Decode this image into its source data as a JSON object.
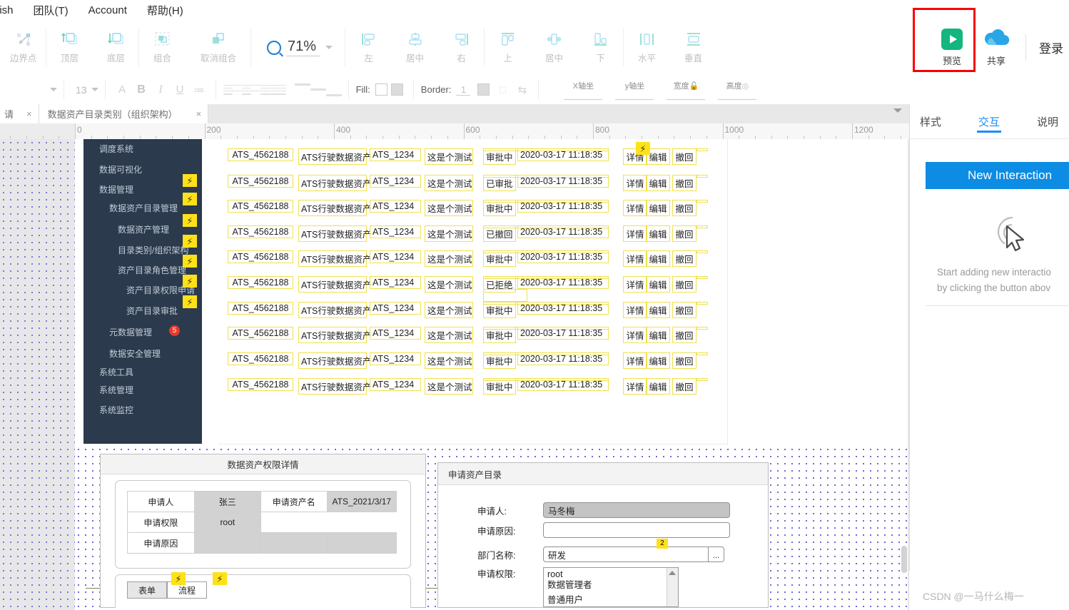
{
  "menubar": {
    "items": [
      {
        "label": "lish",
        "name": "menu-english"
      },
      {
        "label": "团队(T)",
        "name": "menu-team"
      },
      {
        "label": "Account",
        "name": "menu-account"
      },
      {
        "label": "帮助(H)",
        "name": "menu-help"
      }
    ]
  },
  "toolbar": {
    "groups": [
      {
        "name": "points",
        "buttons": [
          {
            "label": "边界点",
            "icon": "boundary-point-icon"
          }
        ]
      },
      {
        "name": "layer",
        "buttons": [
          {
            "label": "顶层",
            "icon": "bring-to-front-icon"
          },
          {
            "label": "底层",
            "icon": "send-to-back-icon"
          }
        ]
      },
      {
        "name": "group",
        "buttons": [
          {
            "label": "组合",
            "icon": "group-icon"
          },
          {
            "label": "取消组合",
            "icon": "ungroup-icon"
          }
        ]
      },
      {
        "name": "align-h",
        "buttons": [
          {
            "label": "左",
            "icon": "align-left-icon"
          },
          {
            "label": "居中",
            "icon": "align-center-icon"
          },
          {
            "label": "右",
            "icon": "align-right-icon"
          }
        ]
      },
      {
        "name": "align-v",
        "buttons": [
          {
            "label": "上",
            "icon": "align-top-icon"
          },
          {
            "label": "居中",
            "icon": "align-middle-icon"
          },
          {
            "label": "下",
            "icon": "align-bottom-icon"
          }
        ]
      },
      {
        "name": "distribute",
        "buttons": [
          {
            "label": "水平",
            "icon": "distribute-horizontal-icon"
          },
          {
            "label": "垂直",
            "icon": "distribute-vertical-icon"
          }
        ]
      }
    ],
    "zoom": {
      "value": "71%",
      "icon": "magnifier-icon"
    },
    "preview": {
      "label": "预览",
      "icon": "play-icon",
      "color": "#13b67f",
      "highlighted": true
    },
    "share": {
      "label": "共享",
      "icon": "cloud-icon",
      "color": "#29a3e8"
    },
    "login": {
      "label": "登录"
    }
  },
  "toolbar2": {
    "font_size": "13",
    "text_buttons": [
      {
        "label": "A",
        "name": "font-color-button"
      },
      {
        "label": "B",
        "name": "bold-button"
      },
      {
        "label": "I",
        "name": "italic-button"
      },
      {
        "label": "U",
        "name": "underline-button"
      },
      {
        "label": "≔",
        "name": "list-button"
      }
    ],
    "fill_label": "Fill:",
    "border_label": "Border:",
    "border_width": "1",
    "position_fields": [
      {
        "label": "X轴坐",
        "name": "x-coordinate-field"
      },
      {
        "label": "y轴坐",
        "name": "y-coordinate-field"
      },
      {
        "label": "宽度",
        "name": "width-field",
        "icon": "lock-icon"
      },
      {
        "label": "高度",
        "name": "height-field",
        "icon": "eye-icon"
      }
    ]
  },
  "tabs": {
    "items": [
      {
        "label": "请",
        "close": "×",
        "active": false
      },
      {
        "label": "数据资产目录类别（组织架构）",
        "close": "×",
        "active": true
      }
    ]
  },
  "ruler": {
    "ticks": [
      "0",
      "200",
      "400",
      "600",
      "800",
      "1000",
      "1200"
    ]
  },
  "sidebar": {
    "items": [
      {
        "label": "调度系统",
        "indent": 0,
        "bolt": false
      },
      {
        "label": "数据可视化",
        "indent": 0,
        "bolt": false
      },
      {
        "label": "数据管理",
        "indent": 0,
        "bolt": true
      },
      {
        "label": "数据资产目录管理",
        "indent": 1,
        "bolt": true
      },
      {
        "label": "数据资产管理",
        "indent": 2,
        "bolt": true
      },
      {
        "label": "目录类别/组织架构",
        "indent": 2,
        "bolt": true
      },
      {
        "label": "资产目录角色管理",
        "indent": 2,
        "bolt": true
      },
      {
        "label": "资产目录权限申请",
        "indent": 3,
        "bolt": true
      },
      {
        "label": "资产目录审批",
        "indent": 2,
        "bolt": true
      },
      {
        "label": "元数据管理",
        "indent": 1,
        "bolt": false,
        "badge": "5"
      },
      {
        "label": "数据安全管理",
        "indent": 1,
        "bolt": false
      },
      {
        "label": "系统工具",
        "indent": 0,
        "bolt": false
      },
      {
        "label": "系统管理",
        "indent": 0,
        "bolt": false
      },
      {
        "label": "系统监控",
        "indent": 0,
        "bolt": false
      }
    ]
  },
  "table": {
    "actions": [
      "详情",
      "编辑",
      "撤回"
    ],
    "rows": [
      {
        "code": "ATS_4562188",
        "name": "ATS行驶数据资产",
        "id": "ATS_1234",
        "desc": "这是个测试",
        "status": "审批中",
        "time": "2020-03-17 11:18:35",
        "bolt": true
      },
      {
        "code": "ATS_4562188",
        "name": "ATS行驶数据资产",
        "id": "ATS_1234",
        "desc": "这是个测试",
        "status": "已审批",
        "time": "2020-03-17 11:18:35",
        "bolt": false
      },
      {
        "code": "ATS_4562188",
        "name": "ATS行驶数据资产",
        "id": "ATS_1234",
        "desc": "这是个测试",
        "status": "审批中",
        "time": "2020-03-17 11:18:35",
        "bolt": false
      },
      {
        "code": "ATS_4562188",
        "name": "ATS行驶数据资产",
        "id": "ATS_1234",
        "desc": "这是个测试",
        "status": "已撤回",
        "time": "2020-03-17 11:18:35",
        "bolt": false
      },
      {
        "code": "ATS_4562188",
        "name": "ATS行驶数据资产",
        "id": "ATS_1234",
        "desc": "这是个测试",
        "status": "审批中",
        "time": "2020-03-17 11:18:35",
        "bolt": false
      },
      {
        "code": "ATS_4562188",
        "name": "ATS行驶数据资产",
        "id": "ATS_1234",
        "desc": "这是个测试",
        "status": "已拒绝",
        "time": "2020-03-17 11:18:35",
        "bolt": false
      },
      {
        "code": "ATS_4562188",
        "name": "ATS行驶数据资产",
        "id": "ATS_1234",
        "desc": "这是个测试",
        "status": "审批中",
        "time": "2020-03-17 11:18:35",
        "bolt": false
      },
      {
        "code": "ATS_4562188",
        "name": "ATS行驶数据资产",
        "id": "ATS_1234",
        "desc": "这是个测试",
        "status": "审批中",
        "time": "2020-03-17 11:18:35",
        "bolt": false
      },
      {
        "code": "ATS_4562188",
        "name": "ATS行驶数据资产",
        "id": "ATS_1234",
        "desc": "这是个测试",
        "status": "审批中",
        "time": "2020-03-17 11:18:35",
        "bolt": false
      },
      {
        "code": "ATS_4562188",
        "name": "ATS行驶数据资产",
        "id": "ATS_1234",
        "desc": "这是个测试",
        "status": "审批中",
        "time": "2020-03-17 11:18:35",
        "bolt": false
      }
    ]
  },
  "detail_card": {
    "title": "数据资产权限详情",
    "grid": {
      "r1": [
        "申请人",
        "张三",
        "申请资产名",
        "ATS_2021/3/17"
      ],
      "r2": [
        "申请权限",
        "root",
        "",
        ""
      ],
      "r3": [
        "申请原因",
        "",
        "",
        ""
      ]
    },
    "tabs": [
      {
        "label": "表单",
        "active": true,
        "bolt": true
      },
      {
        "label": "流程",
        "active": false,
        "bolt": true
      }
    ]
  },
  "apply_card": {
    "title": "申请资产目录",
    "fields": [
      {
        "label": "申请人:",
        "value": "马冬梅",
        "type": "readonly"
      },
      {
        "label": "申请原因:",
        "value": "",
        "type": "input"
      },
      {
        "label": "部门名称:",
        "value": "研发",
        "type": "input-picker",
        "picker": "...",
        "badge": "2"
      },
      {
        "label": "申请权限:",
        "value": "",
        "type": "list"
      }
    ],
    "list_options": [
      "root",
      "数据管理者",
      "",
      "普通用户"
    ]
  },
  "right_panel": {
    "tabs": [
      {
        "label": "样式",
        "active": false
      },
      {
        "label": "交互",
        "active": true
      },
      {
        "label": "说明",
        "active": false
      }
    ],
    "new_interaction": "New Interaction",
    "empty_line1": "Start adding new interactio",
    "empty_line2": "by clicking the button abov",
    "accent": "#1a8cff"
  },
  "watermark": "CSDN @一马什么梅一"
}
